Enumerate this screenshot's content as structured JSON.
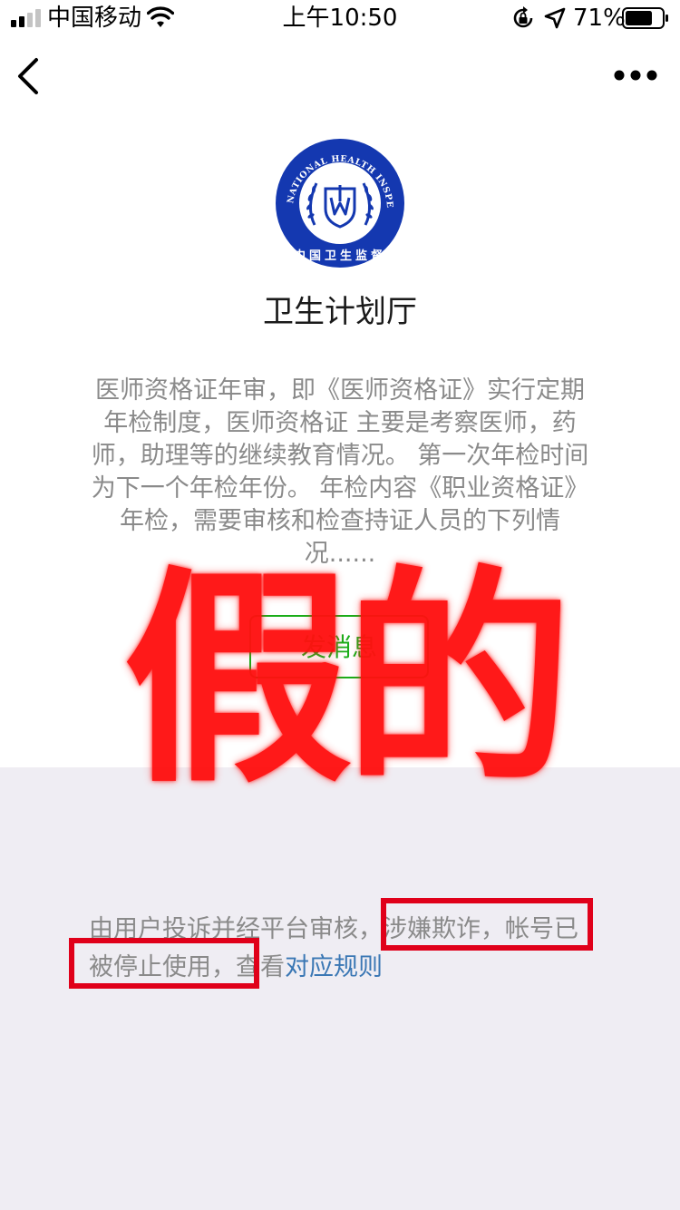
{
  "status_bar": {
    "carrier": "中国移动",
    "time": "上午10:50",
    "battery_percent": "71%",
    "icons": [
      "signal-icon",
      "wifi-icon",
      "lock-rotation-icon",
      "location-icon",
      "battery-icon"
    ]
  },
  "nav": {
    "back_icon": "back-icon",
    "more_icon": "more-icon"
  },
  "logo": {
    "ring_text": "CHINA NATIONAL HEALTH INSPECTION",
    "ring_text_cn": "中国卫生监督",
    "colors": {
      "ring": "#1438b0",
      "inner": "#ffffff"
    }
  },
  "account": {
    "name": "卫生计划厅"
  },
  "description": "医师资格证年审，即《医师资格证》实行定期年检制度，医师资格证 主要是考察医师，药师，助理等的继续教育情况。 第一次年检时间为下一个年检年份。 年检内容《职业资格证》年检，需要审核和检查持证人员的下列情况......",
  "send_button": {
    "label": "发消息",
    "color": "#1aad19"
  },
  "overlay": {
    "text": "假的",
    "color": "#ff1010"
  },
  "notice": {
    "part1": "由用户投诉并经平台审核，",
    "part2": "涉嫌欺诈，帐号",
    "part3": "已被停止使用，",
    "part4": "查看",
    "link": "对应规则",
    "highlight_color": "#e0001a",
    "link_color": "#3a77b4"
  }
}
